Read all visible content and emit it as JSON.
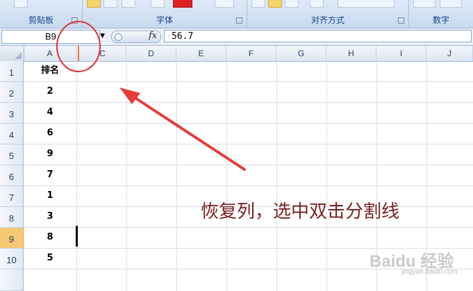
{
  "ribbon": {
    "groups": [
      {
        "label": "剪贴板"
      },
      {
        "label": "字体"
      },
      {
        "label": "对齐方式"
      },
      {
        "label": "数字"
      }
    ]
  },
  "formula_bar": {
    "name_box": "B9",
    "fx": "fx",
    "value": "56.7"
  },
  "columns": [
    "A",
    "C",
    "D",
    "E",
    "F",
    "G",
    "H",
    "I",
    "J"
  ],
  "rows": [
    "1",
    "2",
    "3",
    "4",
    "5",
    "6",
    "7",
    "8",
    "9",
    "10"
  ],
  "selected_row": "9",
  "cells_a": [
    "排名",
    "2",
    "4",
    "6",
    "9",
    "7",
    "1",
    "3",
    "8",
    "5"
  ],
  "annotation": {
    "text": "恢复列，选中双击分割线",
    "color": "#7a1f1f",
    "circle_color": "#e03030",
    "arrow_color": "#e83b3b"
  },
  "watermark": {
    "text": "Baidu 经验",
    "sub": "jingyan.baidu.com"
  }
}
